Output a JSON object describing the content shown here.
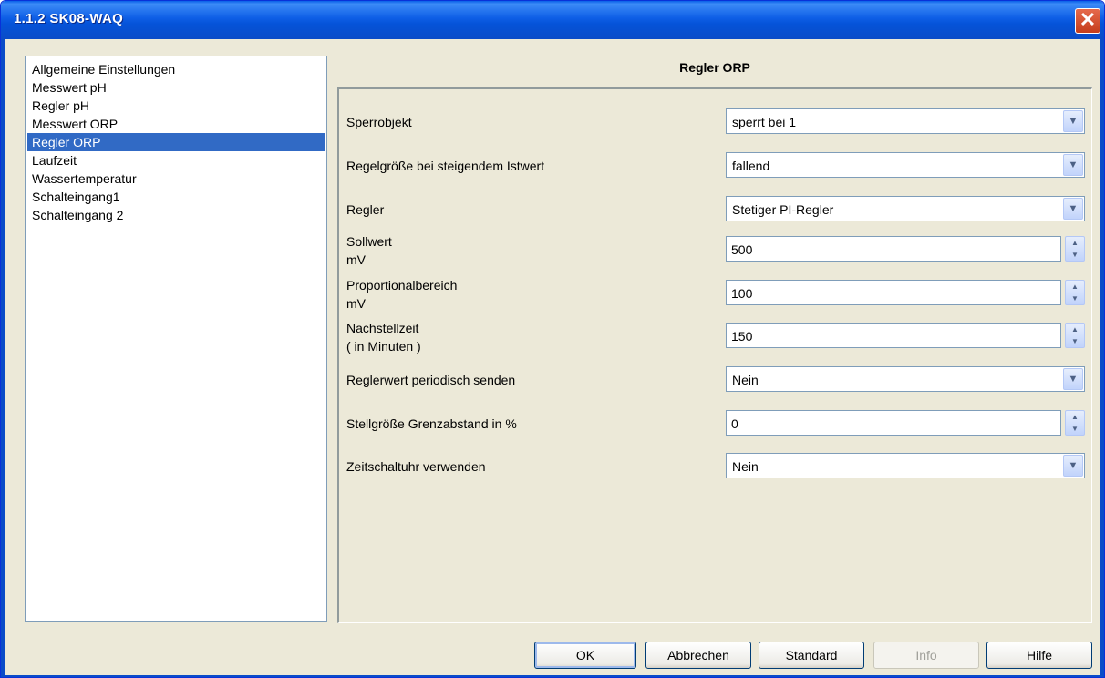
{
  "window": {
    "title": "1.1.2 SK08-WAQ",
    "close_glyph": "✕"
  },
  "nav": {
    "items": [
      {
        "label": "Allgemeine Einstellungen",
        "selected": false
      },
      {
        "label": "Messwert pH",
        "selected": false
      },
      {
        "label": "Regler pH",
        "selected": false
      },
      {
        "label": "Messwert ORP",
        "selected": false
      },
      {
        "label": "Regler ORP",
        "selected": true
      },
      {
        "label": "Laufzeit",
        "selected": false
      },
      {
        "label": "Wassertemperatur",
        "selected": false
      },
      {
        "label": "Schalteingang1",
        "selected": false
      },
      {
        "label": "Schalteingang 2",
        "selected": false
      }
    ]
  },
  "panel": {
    "title": "Regler ORP",
    "params": [
      {
        "label": "Sperrobjekt",
        "control": "select",
        "value": "sperrt bei 1"
      },
      {
        "label": "Regelgröße bei steigendem Istwert",
        "control": "select",
        "value": "fallend"
      },
      {
        "label": "Regler",
        "control": "select",
        "value": "Stetiger PI-Regler"
      },
      {
        "label": "Sollwert",
        "label2": "mV",
        "control": "spin",
        "value": "500"
      },
      {
        "label": "Proportionalbereich",
        "label2": "mV",
        "control": "spin",
        "value": "100"
      },
      {
        "label": "Nachstellzeit",
        "label2": "( in Minuten )",
        "control": "spin",
        "value": "150"
      },
      {
        "label": "Reglerwert periodisch senden",
        "control": "select",
        "value": "Nein"
      },
      {
        "label": "Stellgröße Grenzabstand in %",
        "control": "spin",
        "value": "0"
      },
      {
        "label": "Zeitschaltuhr verwenden",
        "control": "select",
        "value": "Nein"
      }
    ]
  },
  "buttons": {
    "ok": "OK",
    "cancel": "Abbrechen",
    "standard": "Standard",
    "info": "Info",
    "help": "Hilfe"
  },
  "colors": {
    "titlebar": "#0553d8",
    "selection": "#316ac5",
    "dialog_bg": "#ece9d8"
  },
  "icons": {
    "dropdown": "chevron-down-icon",
    "spin_up": "spin-up-icon",
    "spin_down": "spin-down-icon",
    "close": "close-icon"
  }
}
